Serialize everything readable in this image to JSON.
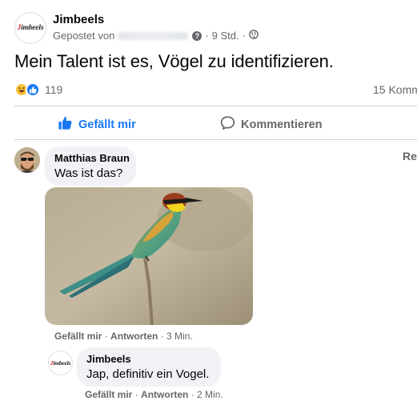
{
  "post": {
    "page_name": "Jimbeels",
    "posted_by_prefix": "Gepostet von",
    "time": "9 Std.",
    "text": "Mein Talent ist es, Vögel zu identifizieren.",
    "logo_text_1": "J",
    "logo_text_2": "imbeels"
  },
  "reactions": {
    "count": "119",
    "comment_count": "15 Komm",
    "icons": [
      "haha-icon",
      "like-icon"
    ]
  },
  "actions": {
    "like_label": "Gefällt mir",
    "comment_label": "Kommentieren"
  },
  "sort": {
    "label": "Re"
  },
  "comments": [
    {
      "author": "Matthias Braun",
      "text": "Was ist das?",
      "like": "Gefällt mir",
      "reply": "Antworten",
      "time": "3 Min."
    },
    {
      "author": "Jimbeels",
      "text": "Jap, definitiv ein Vogel.",
      "like": "Gefällt mir",
      "reply": "Antworten",
      "time": "2 Min."
    }
  ],
  "colors": {
    "accent": "#1877f2",
    "secondary_text": "#65676b",
    "bubble": "#f0f2f5"
  }
}
